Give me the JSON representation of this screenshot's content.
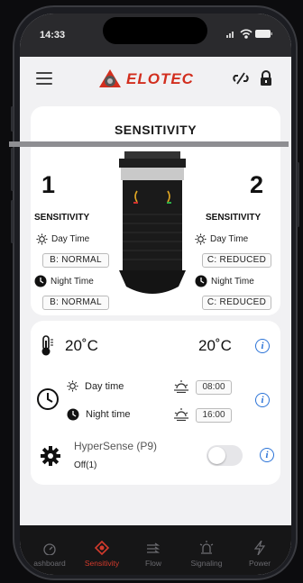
{
  "status": {
    "time": "14:33",
    "icons": [
      "location-arrow-icon",
      "signal-icon",
      "wifi-icon",
      "battery-icon"
    ]
  },
  "header": {
    "logo_text": "ELOTEC",
    "menu_icon": "hamburger-icon",
    "link_icon": "link-off-icon",
    "lock_icon": "lock-icon"
  },
  "sensitivity": {
    "title": "SENSITIVITY",
    "zones": [
      {
        "number": "1",
        "label": "SENSITIVITY",
        "day_label": "Day Time",
        "day_value": "B: NORMAL",
        "night_label": "Night Time",
        "night_value": "B: NORMAL"
      },
      {
        "number": "2",
        "label": "SENSITIVITY",
        "day_label": "Day Time",
        "day_value": "C: REDUCED",
        "night_label": "Night Time",
        "night_value": "C: REDUCED"
      }
    ]
  },
  "settings": {
    "temp_left": "20˚C",
    "temp_right": "20˚C",
    "day_label": "Day time",
    "day_time": "08:00",
    "night_label": "Night time",
    "night_time": "16:00",
    "hypersense_label": "HyperSense (P9)",
    "hypersense_value": "Off(1)",
    "hypersense_on": false,
    "info_symbol": "i"
  },
  "tabs": [
    {
      "label": "ashboard",
      "icon": "gauge-icon",
      "active": false
    },
    {
      "label": "Sensitivity",
      "icon": "sensitivity-icon",
      "active": true
    },
    {
      "label": "Flow",
      "icon": "flow-arrows-icon",
      "active": false
    },
    {
      "label": "Signaling",
      "icon": "signal-light-icon",
      "active": false
    },
    {
      "label": "Power",
      "icon": "lightning-icon",
      "active": false
    }
  ],
  "colors": {
    "brand_red": "#d22e1e",
    "info_blue": "#2b73d7",
    "active_tab": "#d23a2c"
  }
}
